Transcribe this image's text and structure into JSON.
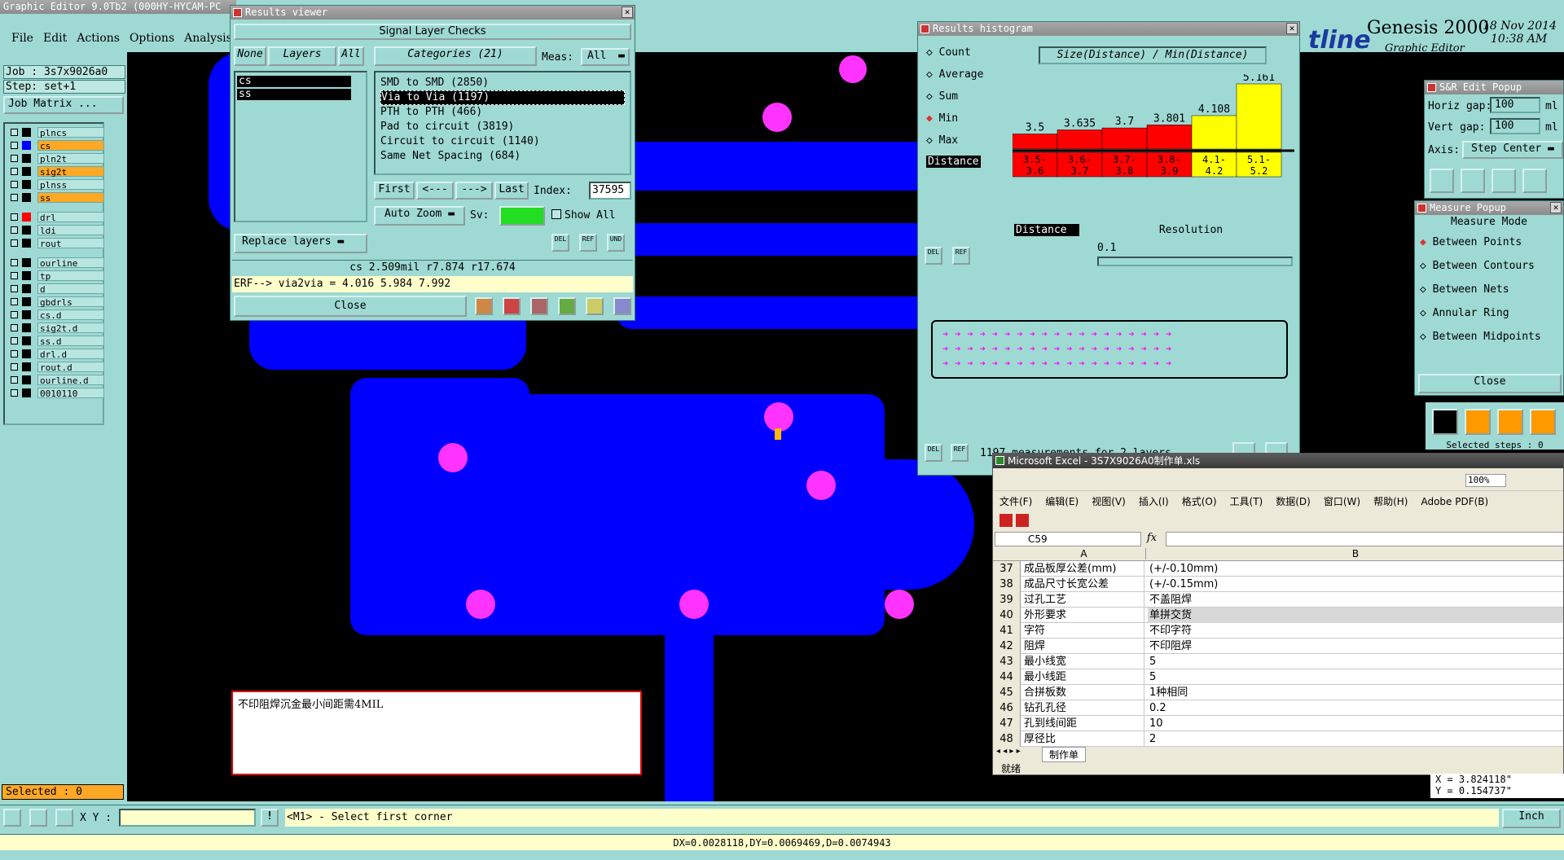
{
  "app": {
    "title": "Graphic Editor 9.0Tb2 (000HY-HYCAM-PC",
    "brand": "Genesis 2000",
    "brand_sub": "Graphic Editor",
    "brand_logo_text": "tline",
    "date": "18 Nov 2014",
    "time": "10:38 AM"
  },
  "menubar": [
    "File",
    "Edit",
    "Actions",
    "Options",
    "Analysis"
  ],
  "left": {
    "job": "Job : 3s7x9026a0",
    "step": "Step: set+1",
    "job_matrix": "Job Matrix ...",
    "selected": "Selected : 0",
    "layers": [
      {
        "name": "plncs",
        "color": "#000000",
        "hl": false
      },
      {
        "name": "cs",
        "color": "#0000ff",
        "hl": true
      },
      {
        "name": "pln2t",
        "color": "#000000",
        "hl": false
      },
      {
        "name": "sig2t",
        "color": "#000000",
        "hl": true
      },
      {
        "name": "plnss",
        "color": "#000000",
        "hl": false
      },
      {
        "name": "ss",
        "color": "#000000",
        "hl": true
      },
      {
        "name": "drl",
        "color": "#ff0000",
        "hl": false
      },
      {
        "name": "ldi",
        "color": "#000000",
        "hl": false
      },
      {
        "name": "rout",
        "color": "#000000",
        "hl": false
      },
      {
        "name": "ourline",
        "color": "#000000",
        "hl": false
      },
      {
        "name": "tp",
        "color": "#000000",
        "hl": false
      },
      {
        "name": "d",
        "color": "#000000",
        "hl": false
      },
      {
        "name": "gbdrls",
        "color": "#000000",
        "hl": false
      },
      {
        "name": "cs.d",
        "color": "#000000",
        "hl": false
      },
      {
        "name": "sig2t.d",
        "color": "#000000",
        "hl": false
      },
      {
        "name": "ss.d",
        "color": "#000000",
        "hl": false
      },
      {
        "name": "drl.d",
        "color": "#000000",
        "hl": false
      },
      {
        "name": "rout.d",
        "color": "#000000",
        "hl": false
      },
      {
        "name": "ourline.d",
        "color": "#000000",
        "hl": false
      },
      {
        "name": "0010110",
        "color": "#000000",
        "hl": false
      }
    ]
  },
  "results": {
    "title": "Results viewer",
    "header": "Signal Layer Checks",
    "none": "None",
    "layers": "Layers",
    "all": "All",
    "categories": "Categories (21)",
    "meas": "Meas:",
    "meas_val": "All",
    "layer_list": [
      "cs",
      "ss"
    ],
    "cat_list": [
      "SMD to SMD (2850)",
      "Via to Via (1197)",
      "PTH to PTH (466)",
      "Pad to circuit (3819)",
      "Circuit to circuit (1140)",
      "Same Net Spacing (684)"
    ],
    "first": "First",
    "prev": "<---",
    "next": "--->",
    "last": "Last",
    "index_label": "Index:",
    "index_val": "37595",
    "auto_zoom": "Auto Zoom",
    "sv": "Sv:",
    "show_all": "Show All",
    "replace": "Replace layers",
    "info": "cs 2.509mil  r7.874  r17.674",
    "erf": "ERF--> via2via = 4.016 5.984 7.992",
    "close": "Close",
    "del": "DEL",
    "ref": "REF",
    "und": "UND"
  },
  "histogram": {
    "title": "Results histogram",
    "options": [
      "Count",
      "Average",
      "Sum",
      "Min",
      "Max"
    ],
    "selected": "Min",
    "distance": "Distance",
    "chart_title": "Size(Distance) / Min(Distance)",
    "resolution": "Resolution",
    "res_val": "0.1",
    "footer": "1197 measurements for 2 layers",
    "del": "DEL",
    "ref": "REF"
  },
  "chart_data": {
    "type": "bar",
    "title": "Size(Distance) / Min(Distance)",
    "categories": [
      "3.5-3.6",
      "3.6-3.7",
      "3.7-3.8",
      "3.8-3.9",
      "4.1-4.2",
      "5.1-5.2"
    ],
    "values": [
      3.5,
      3.635,
      3.7,
      3.801,
      4.108,
      5.161
    ],
    "value_labels": [
      "3.5",
      "3.635",
      "3.7",
      "3.801",
      "4.108",
      "5.161"
    ],
    "colors": [
      "#ff0000",
      "#ff0000",
      "#ff0000",
      "#ff0000",
      "#ffff00",
      "#ffff00"
    ],
    "category_lines": [
      [
        "3.5-",
        "3.6"
      ],
      [
        "3.6-",
        "3.7"
      ],
      [
        "3.7-",
        "3.8"
      ],
      [
        "3.8-",
        "3.9"
      ],
      [
        "4.1-",
        "4.2"
      ],
      [
        "5.1-",
        "5.2"
      ]
    ]
  },
  "snr": {
    "title": "S&R Edit Popup",
    "hgap": "Horiz gap:",
    "hgap_val": "100",
    "vgap": "Vert  gap:",
    "vgap_val": "100",
    "unit": "ml",
    "axis": "Axis:",
    "axis_val": "Step Center"
  },
  "measure": {
    "title": "Measure Popup",
    "mode": "Measure Mode",
    "items": [
      "Between Points",
      "Between Contours",
      "Between Nets",
      "Annular Ring",
      "Between Midpoints"
    ],
    "selected": "Between Points",
    "close": "Close",
    "selected_steps": "Selected steps : 0"
  },
  "note": "不印阻焊沉金最小间距需4MIL",
  "excel": {
    "title": "Microsoft Excel - 3S7X9026A0制作单.xls",
    "menu": [
      "文件(F)",
      "编辑(E)",
      "视图(V)",
      "插入(I)",
      "格式(O)",
      "工具(T)",
      "数据(D)",
      "窗口(W)",
      "帮助(H)",
      "Adobe PDF(B)"
    ],
    "cell_ref": "C59",
    "fx": "fx",
    "zoom": "100%",
    "col_a": "A",
    "col_b": "B",
    "sheet": "制作单",
    "status": "就绪",
    "rows": [
      [
        "37",
        "成品板厚公差(mm)",
        "(+/-0.10mm)"
      ],
      [
        "38",
        "成品尺寸长宽公差",
        "(+/-0.15mm)"
      ],
      [
        "39",
        "过孔工艺",
        "不盖阻焊"
      ],
      [
        "40",
        "外形要求",
        "单拼交货"
      ],
      [
        "41",
        "字符",
        "不印字符"
      ],
      [
        "42",
        "阻焊",
        "不印阻焊"
      ],
      [
        "43",
        "最小线宽",
        "5"
      ],
      [
        "44",
        "最小线距",
        "5"
      ],
      [
        "45",
        "合拼板数",
        "1种相同"
      ],
      [
        "46",
        "钻孔孔径",
        "0.2"
      ],
      [
        "47",
        "孔到线间距",
        "10"
      ],
      [
        "48",
        "厚径比",
        "2"
      ]
    ]
  },
  "bottom": {
    "xy_label": "X Y :",
    "prompt": "<M1> - Select first corner",
    "unit": "Inch",
    "coords": "DX=0.0028118,DY=0.0069469,D=0.0074943",
    "x": "X = 3.824118\"",
    "y": "Y = 0.154737\""
  }
}
